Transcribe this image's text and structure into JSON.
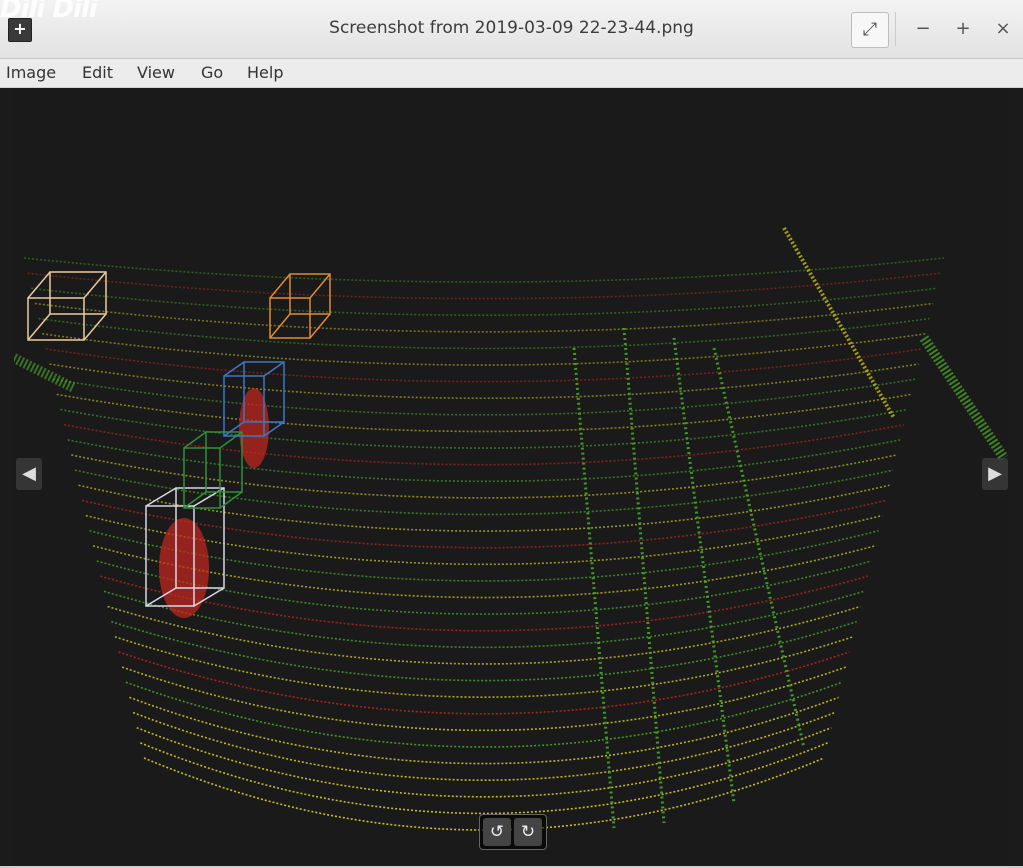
{
  "window": {
    "title": "Screenshot from 2019-03-09 22-23-44.png",
    "app_icon": "plus-square-icon",
    "watermark": "Dili Dili",
    "expand_glyph": "⤢",
    "minimize_glyph": "−",
    "maximize_glyph": "+",
    "close_glyph": "×"
  },
  "menu": [
    {
      "label": "Image"
    },
    {
      "label": "Edit"
    },
    {
      "label": "View"
    },
    {
      "label": "Go"
    },
    {
      "label": "Help"
    }
  ],
  "viewer": {
    "prev_glyph": "◀",
    "next_glyph": "▶",
    "rotate_left_glyph": "↺",
    "rotate_right_glyph": "↻"
  },
  "colors": {
    "point_green": "#4caf2a",
    "point_yellow": "#d7d02a",
    "point_red": "#c8281e",
    "box_white": "#d8d8e8",
    "box_orange": "#e08a35",
    "box_blue": "#3b78c8",
    "box_green": "#2f8f3a",
    "box_peach": "#e9c9a0"
  }
}
